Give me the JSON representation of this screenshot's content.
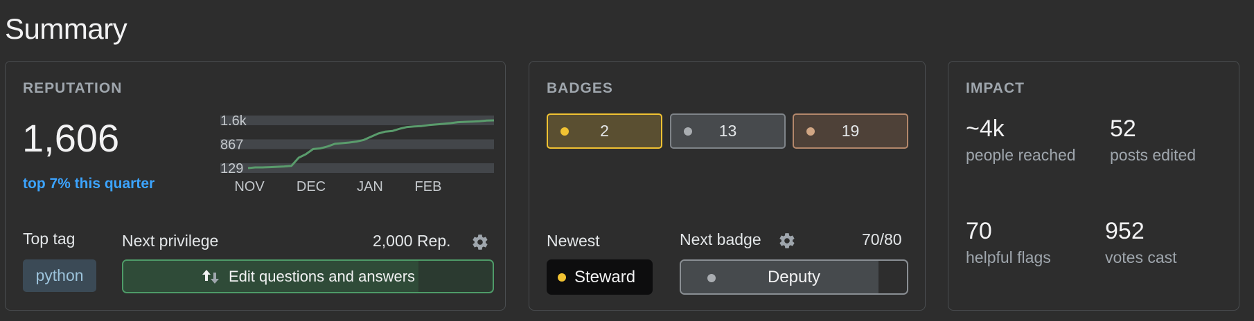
{
  "page": {
    "title": "Summary"
  },
  "reputation": {
    "label": "REPUTATION",
    "value": "1,606",
    "top_text": "top 7% this quarter",
    "top_tag_label": "Top tag",
    "top_tag": "python",
    "next_privilege_label": "Next privilege",
    "next_privilege_rep": "2,000 Rep.",
    "privilege_name": "Edit questions and answers",
    "privilege_progress": 0.8
  },
  "chart_data": {
    "type": "line",
    "y_ticks": [
      "1.6k",
      "867",
      "129"
    ],
    "x_ticks": [
      "NOV",
      "DEC",
      "JAN",
      "FEB"
    ],
    "ylim": [
      129,
      1606
    ],
    "series": [
      {
        "values": [
          129,
          150,
          150,
          160,
          170,
          180,
          200,
          450,
          560,
          720,
          740,
          800,
          880,
          900,
          920,
          950,
          1000,
          1100,
          1200,
          1260,
          1280,
          1350,
          1400,
          1420,
          1430,
          1460,
          1480,
          1500,
          1520,
          1550,
          1560,
          1570,
          1580,
          1600,
          1606
        ]
      }
    ],
    "color": "#5a9c6c"
  },
  "badges": {
    "label": "BADGES",
    "gold": "2",
    "silver": "13",
    "bronze": "19",
    "newest_label": "Newest",
    "newest_badge": "Steward",
    "next_badge_label": "Next badge",
    "next_badge_progress_text": "70/80",
    "next_badge_name": "Deputy",
    "next_badge_progress": 0.875,
    "colors": {
      "gold": "#f1c232",
      "silver": "#a9adb1",
      "bronze": "#d1a684"
    }
  },
  "impact": {
    "label": "IMPACT",
    "people_reached": "~4k",
    "people_reached_label": "people reached",
    "posts_edited": "52",
    "posts_edited_label": "posts edited",
    "helpful_flags": "70",
    "helpful_flags_label": "helpful flags",
    "votes_cast": "952",
    "votes_cast_label": "votes cast"
  },
  "icons": {
    "settings": "gear-icon",
    "edit": "edit-arrows-icon"
  }
}
